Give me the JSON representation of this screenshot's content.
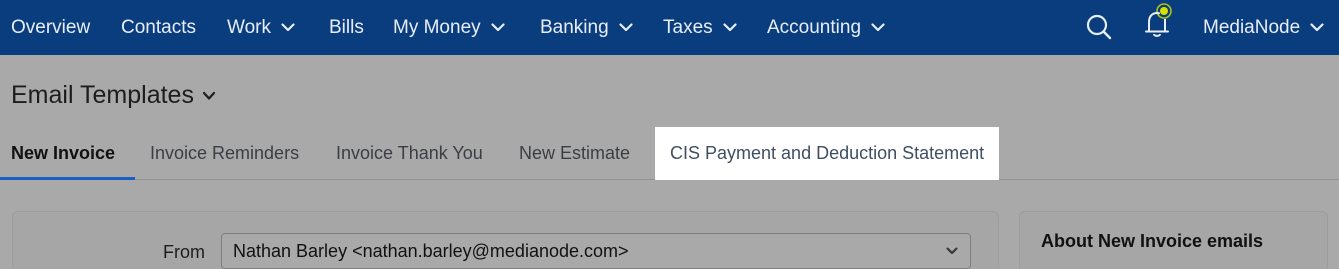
{
  "nav": {
    "items": [
      {
        "label": "Overview",
        "dropdown": false
      },
      {
        "label": "Contacts",
        "dropdown": false
      },
      {
        "label": "Work",
        "dropdown": true
      },
      {
        "label": "Bills",
        "dropdown": false
      },
      {
        "label": "My Money",
        "dropdown": true
      },
      {
        "label": "Banking",
        "dropdown": true
      },
      {
        "label": "Taxes",
        "dropdown": true
      },
      {
        "label": "Accounting",
        "dropdown": true
      }
    ],
    "icons": {
      "search": "search-icon",
      "notifications": "bell-icon"
    },
    "account": {
      "label": "MediaNode",
      "dropdown": true
    },
    "colors": {
      "background": "#0a3d7e",
      "text": "#e8eef7",
      "bell_dot": "#d8e000"
    }
  },
  "page": {
    "title": "Email Templates"
  },
  "tabs": [
    {
      "label": "New Invoice",
      "active": true
    },
    {
      "label": "Invoice Reminders",
      "active": false
    },
    {
      "label": "Invoice Thank You",
      "active": false
    },
    {
      "label": "New Estimate",
      "active": false
    },
    {
      "label": "CIS Payment and Deduction Statement",
      "active": false,
      "highlighted": true
    }
  ],
  "form": {
    "from_label": "From",
    "from_value": "Nathan Barley <nathan.barley@medianode.com>"
  },
  "sidebar": {
    "title": "About New Invoice emails"
  },
  "colors": {
    "accent": "#1a5fc0",
    "overlay": "#a9a9a9",
    "highlight": "#ffffff"
  }
}
